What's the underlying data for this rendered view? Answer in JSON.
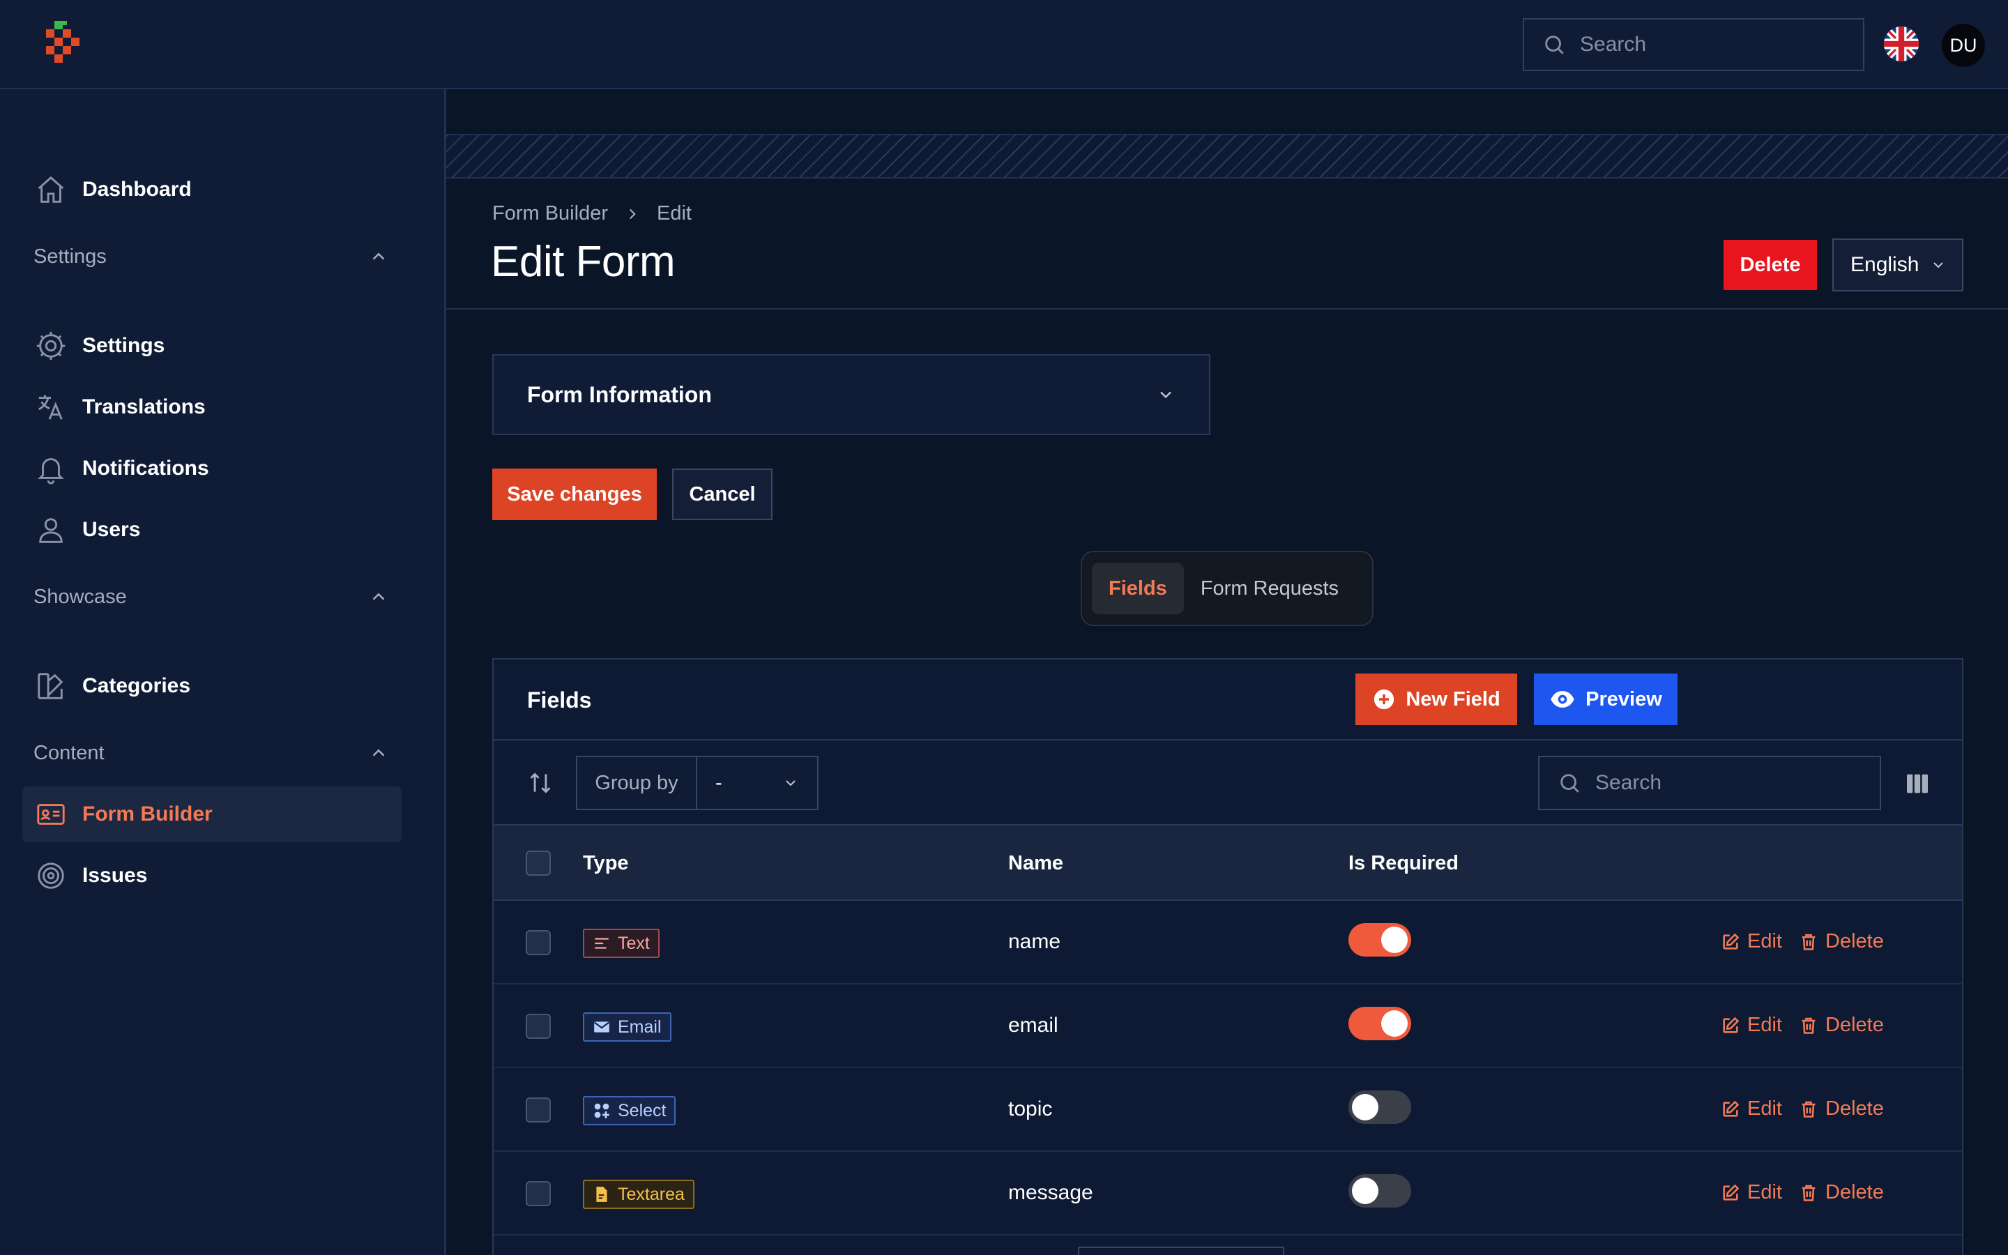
{
  "topbar": {
    "search_placeholder": "Search",
    "avatar_initials": "DU",
    "flag_icon": "uk-flag-icon"
  },
  "sidebar": {
    "dashboard": "Dashboard",
    "groups": [
      {
        "label": "Settings",
        "items": [
          "Settings",
          "Translations",
          "Notifications",
          "Users"
        ]
      },
      {
        "label": "Showcase",
        "items": [
          "Categories"
        ]
      },
      {
        "label": "Content",
        "items": [
          "Form Builder",
          "Issues"
        ]
      }
    ],
    "active_item": "Form Builder"
  },
  "header": {
    "breadcrumb": [
      "Form Builder",
      "Edit"
    ],
    "title": "Edit Form",
    "delete_label": "Delete",
    "language": "English"
  },
  "form_section": {
    "title": "Form Information"
  },
  "actions": {
    "save_label": "Save changes",
    "cancel_label": "Cancel"
  },
  "tabs": [
    {
      "label": "Fields",
      "active": true
    },
    {
      "label": "Form Requests",
      "active": false
    }
  ],
  "fields_table": {
    "title": "Fields",
    "new_label": "New Field",
    "preview_label": "Preview",
    "group_by_label": "Group by",
    "group_by_value": "-",
    "search_placeholder": "Search",
    "columns": [
      "Type",
      "Name",
      "Is Required"
    ],
    "rows": [
      {
        "type": "Text",
        "name": "name",
        "required": true,
        "edit": "Edit",
        "delete": "Delete"
      },
      {
        "type": "Email",
        "name": "email",
        "required": true,
        "edit": "Edit",
        "delete": "Delete"
      },
      {
        "type": "Select",
        "name": "topic",
        "required": false,
        "edit": "Edit",
        "delete": "Delete"
      },
      {
        "type": "Textarea",
        "name": "message",
        "required": false,
        "edit": "Edit",
        "delete": "Delete"
      }
    ]
  },
  "colors": {
    "accent": "#dd4425",
    "primary_blue": "#1e56f0",
    "danger": "#e8151f",
    "background": "#0b1528",
    "surface": "#101c36"
  }
}
